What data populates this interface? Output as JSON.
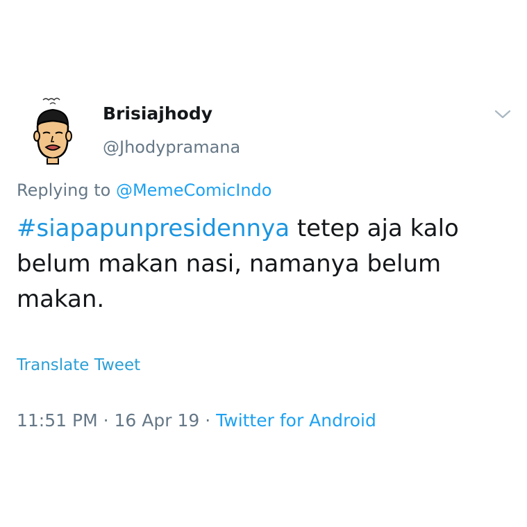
{
  "author": {
    "display_name": "Brisiajhody",
    "handle": "@Jhodypramana",
    "avatar_icon": "cartoon-face-avatar"
  },
  "reply": {
    "prefix": "Replying to ",
    "mention": "@MemeComicIndo"
  },
  "tweet": {
    "hashtag": "#siapapunpresidennya",
    "line1_rest": " tetep aja kalo",
    "line2": "belum makan nasi,  namanya belum",
    "line3": "makan."
  },
  "translate_label": "Translate Tweet",
  "meta": {
    "time": "11:51 PM",
    "separator1": " · ",
    "date": "16 Apr 19",
    "separator2": " · ",
    "source": "Twitter for Android"
  },
  "icons": {
    "menu": "chevron-down-icon"
  },
  "colors": {
    "accent": "#1da1f2",
    "secondary_text": "#657786",
    "primary_text": "#14171a"
  }
}
